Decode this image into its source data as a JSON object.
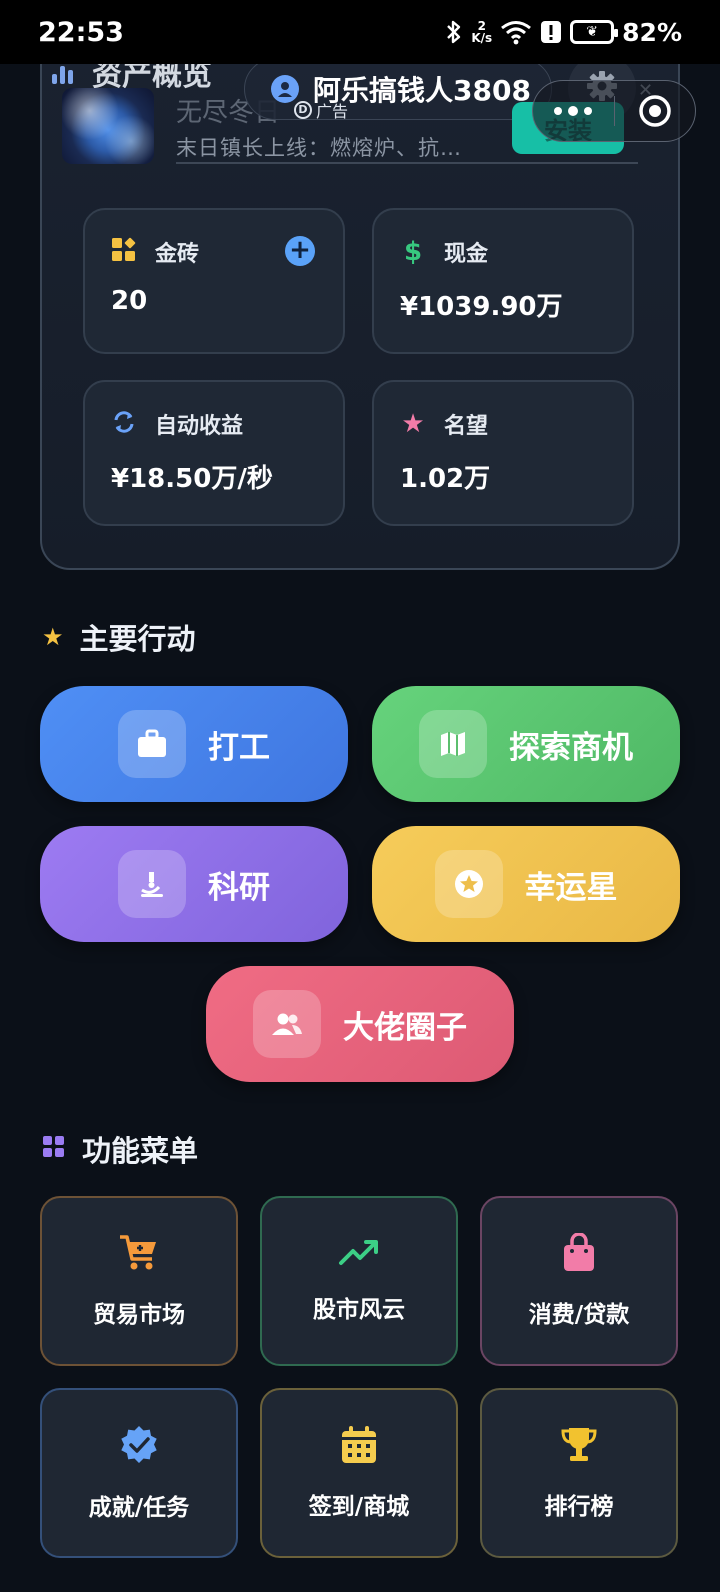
{
  "status_bar": {
    "time": "22:53",
    "net_speed_value": "2",
    "net_speed_unit": "K/s",
    "battery": "82%"
  },
  "asset_card": {
    "title": "资产概览"
  },
  "header": {
    "username": "阿乐搞钱人3808"
  },
  "ad": {
    "app_name": "无尽冬日",
    "tag": "广告",
    "description": "末日镇长上线：燃熔炉、抗…",
    "install_label": "安装"
  },
  "stats": {
    "gold_bricks": {
      "label": "金砖",
      "value": "20"
    },
    "cash": {
      "label": "现金",
      "value": "¥1039.90万"
    },
    "auto_income": {
      "label": "自动收益",
      "value": "¥18.50万/秒"
    },
    "reputation": {
      "label": "名望",
      "value": "1.02万"
    }
  },
  "main_actions": {
    "title": "主要行动",
    "items": [
      {
        "label": "打工",
        "color": "#4a86f0"
      },
      {
        "label": "探索商机",
        "color": "#5ccc72"
      },
      {
        "label": "科研",
        "color": "#8f73ec"
      },
      {
        "label": "幸运星",
        "color": "#f2c64e"
      },
      {
        "label": "大佬圈子",
        "color": "#ec637c"
      }
    ]
  },
  "function_menu": {
    "title": "功能菜单",
    "items": [
      {
        "label": "贸易市场",
        "icon": "cart-icon",
        "color": "#f59a3b"
      },
      {
        "label": "股市风云",
        "icon": "trend-icon",
        "color": "#3ccf86"
      },
      {
        "label": "消费/贷款",
        "icon": "shopping-bag-icon",
        "color": "#f27ca8"
      },
      {
        "label": "成就/任务",
        "icon": "verified-badge-icon",
        "color": "#66a3f7"
      },
      {
        "label": "签到/商城",
        "icon": "calendar-icon",
        "color": "#f5cc4e"
      },
      {
        "label": "排行榜",
        "icon": "trophy-icon",
        "color": "#f2c22f"
      }
    ]
  }
}
